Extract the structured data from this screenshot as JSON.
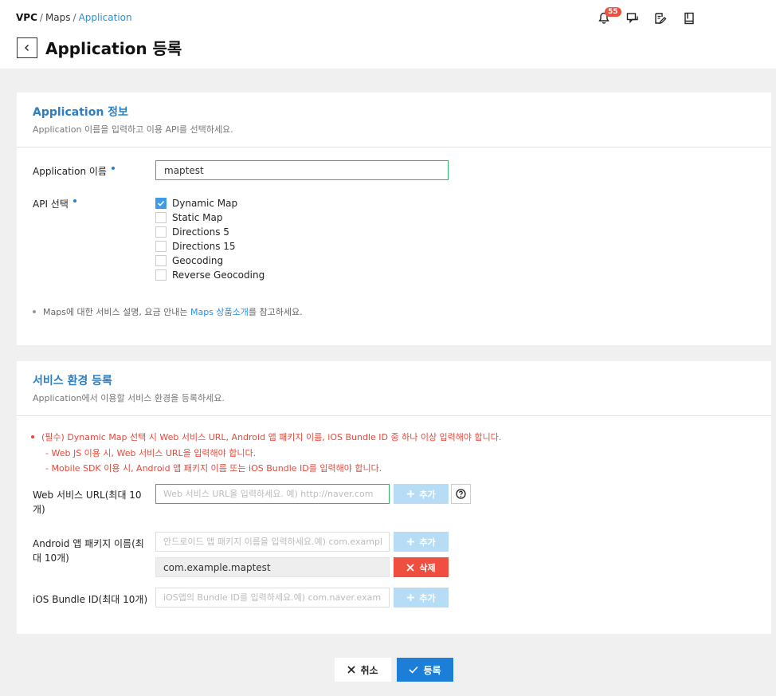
{
  "breadcrumb": {
    "root": "VPC",
    "sep1": "/",
    "mid": "Maps",
    "sep2": "/",
    "current": "Application"
  },
  "header": {
    "title": "Application 등록",
    "notification_count": "55"
  },
  "icons": {
    "back": "chevron-left-icon",
    "bell": "bell-icon",
    "chat": "chat-icon",
    "edit": "edit-icon",
    "book": "book-icon",
    "help": "question-circle-icon",
    "plus": "plus-icon",
    "close": "x-icon",
    "check": "check-icon"
  },
  "app_info": {
    "title": "Application 정보",
    "desc": "Application 이름을 입력하고 이용 API를 선택하세요.",
    "name_label": "Application 이름",
    "name_value": "maptest",
    "api_label": "API 선택",
    "apis": [
      {
        "label": "Dynamic Map",
        "checked": true
      },
      {
        "label": "Static Map",
        "checked": false
      },
      {
        "label": "Directions 5",
        "checked": false
      },
      {
        "label": "Directions 15",
        "checked": false
      },
      {
        "label": "Geocoding",
        "checked": false
      },
      {
        "label": "Reverse Geocoding",
        "checked": false
      }
    ],
    "note_prefix": "Maps에 대한 서비스 설명, 요금 안내는 ",
    "note_link": "Maps 상품소개",
    "note_suffix": "를 참고하세요."
  },
  "service_env": {
    "title": "서비스 환경 등록",
    "desc": "Application에서 이용할 서비스 환경을 등록하세요.",
    "warning_main": "(필수) Dynamic Map 선택 시 Web 서비스 URL, Android 앱 패키지 이름, iOS Bundle ID 중 하나 이상 입력해야 합니다.",
    "warning_sub1": "- Web JS 이용 시, Web 서비스 URL을 입력해야 합니다.",
    "warning_sub2": "- Mobile SDK 이용 시, Android 앱 패키지 이름 또는 iOS Bundle ID를 입력해야 합니다.",
    "web_label": "Web 서비스 URL(최대 10개)",
    "web_placeholder": "Web 서비스 URL을 입력하세요. 예) http://naver.com",
    "android_label": "Android 앱 패키지 이름(최대 10개)",
    "android_placeholder": "안드로이드 앱 패키지 이름을 입력하세요.예) com.example",
    "android_value": "com.example.maptest",
    "ios_label": "iOS Bundle ID(최대 10개)",
    "ios_placeholder": "iOS앱의 Bundle ID를 입력하세요.예) com.naver.example",
    "add_label": "추가",
    "delete_label": "삭제"
  },
  "footer": {
    "cancel_label": "취소",
    "submit_label": "등록"
  },
  "colors": {
    "accent": "#2a7fc4",
    "primary_button": "#1c7ed6",
    "danger": "#f04e3e",
    "warning_text": "#e8483a",
    "focus_border": "#2fb66d",
    "add_button": "#b7ddf6"
  }
}
